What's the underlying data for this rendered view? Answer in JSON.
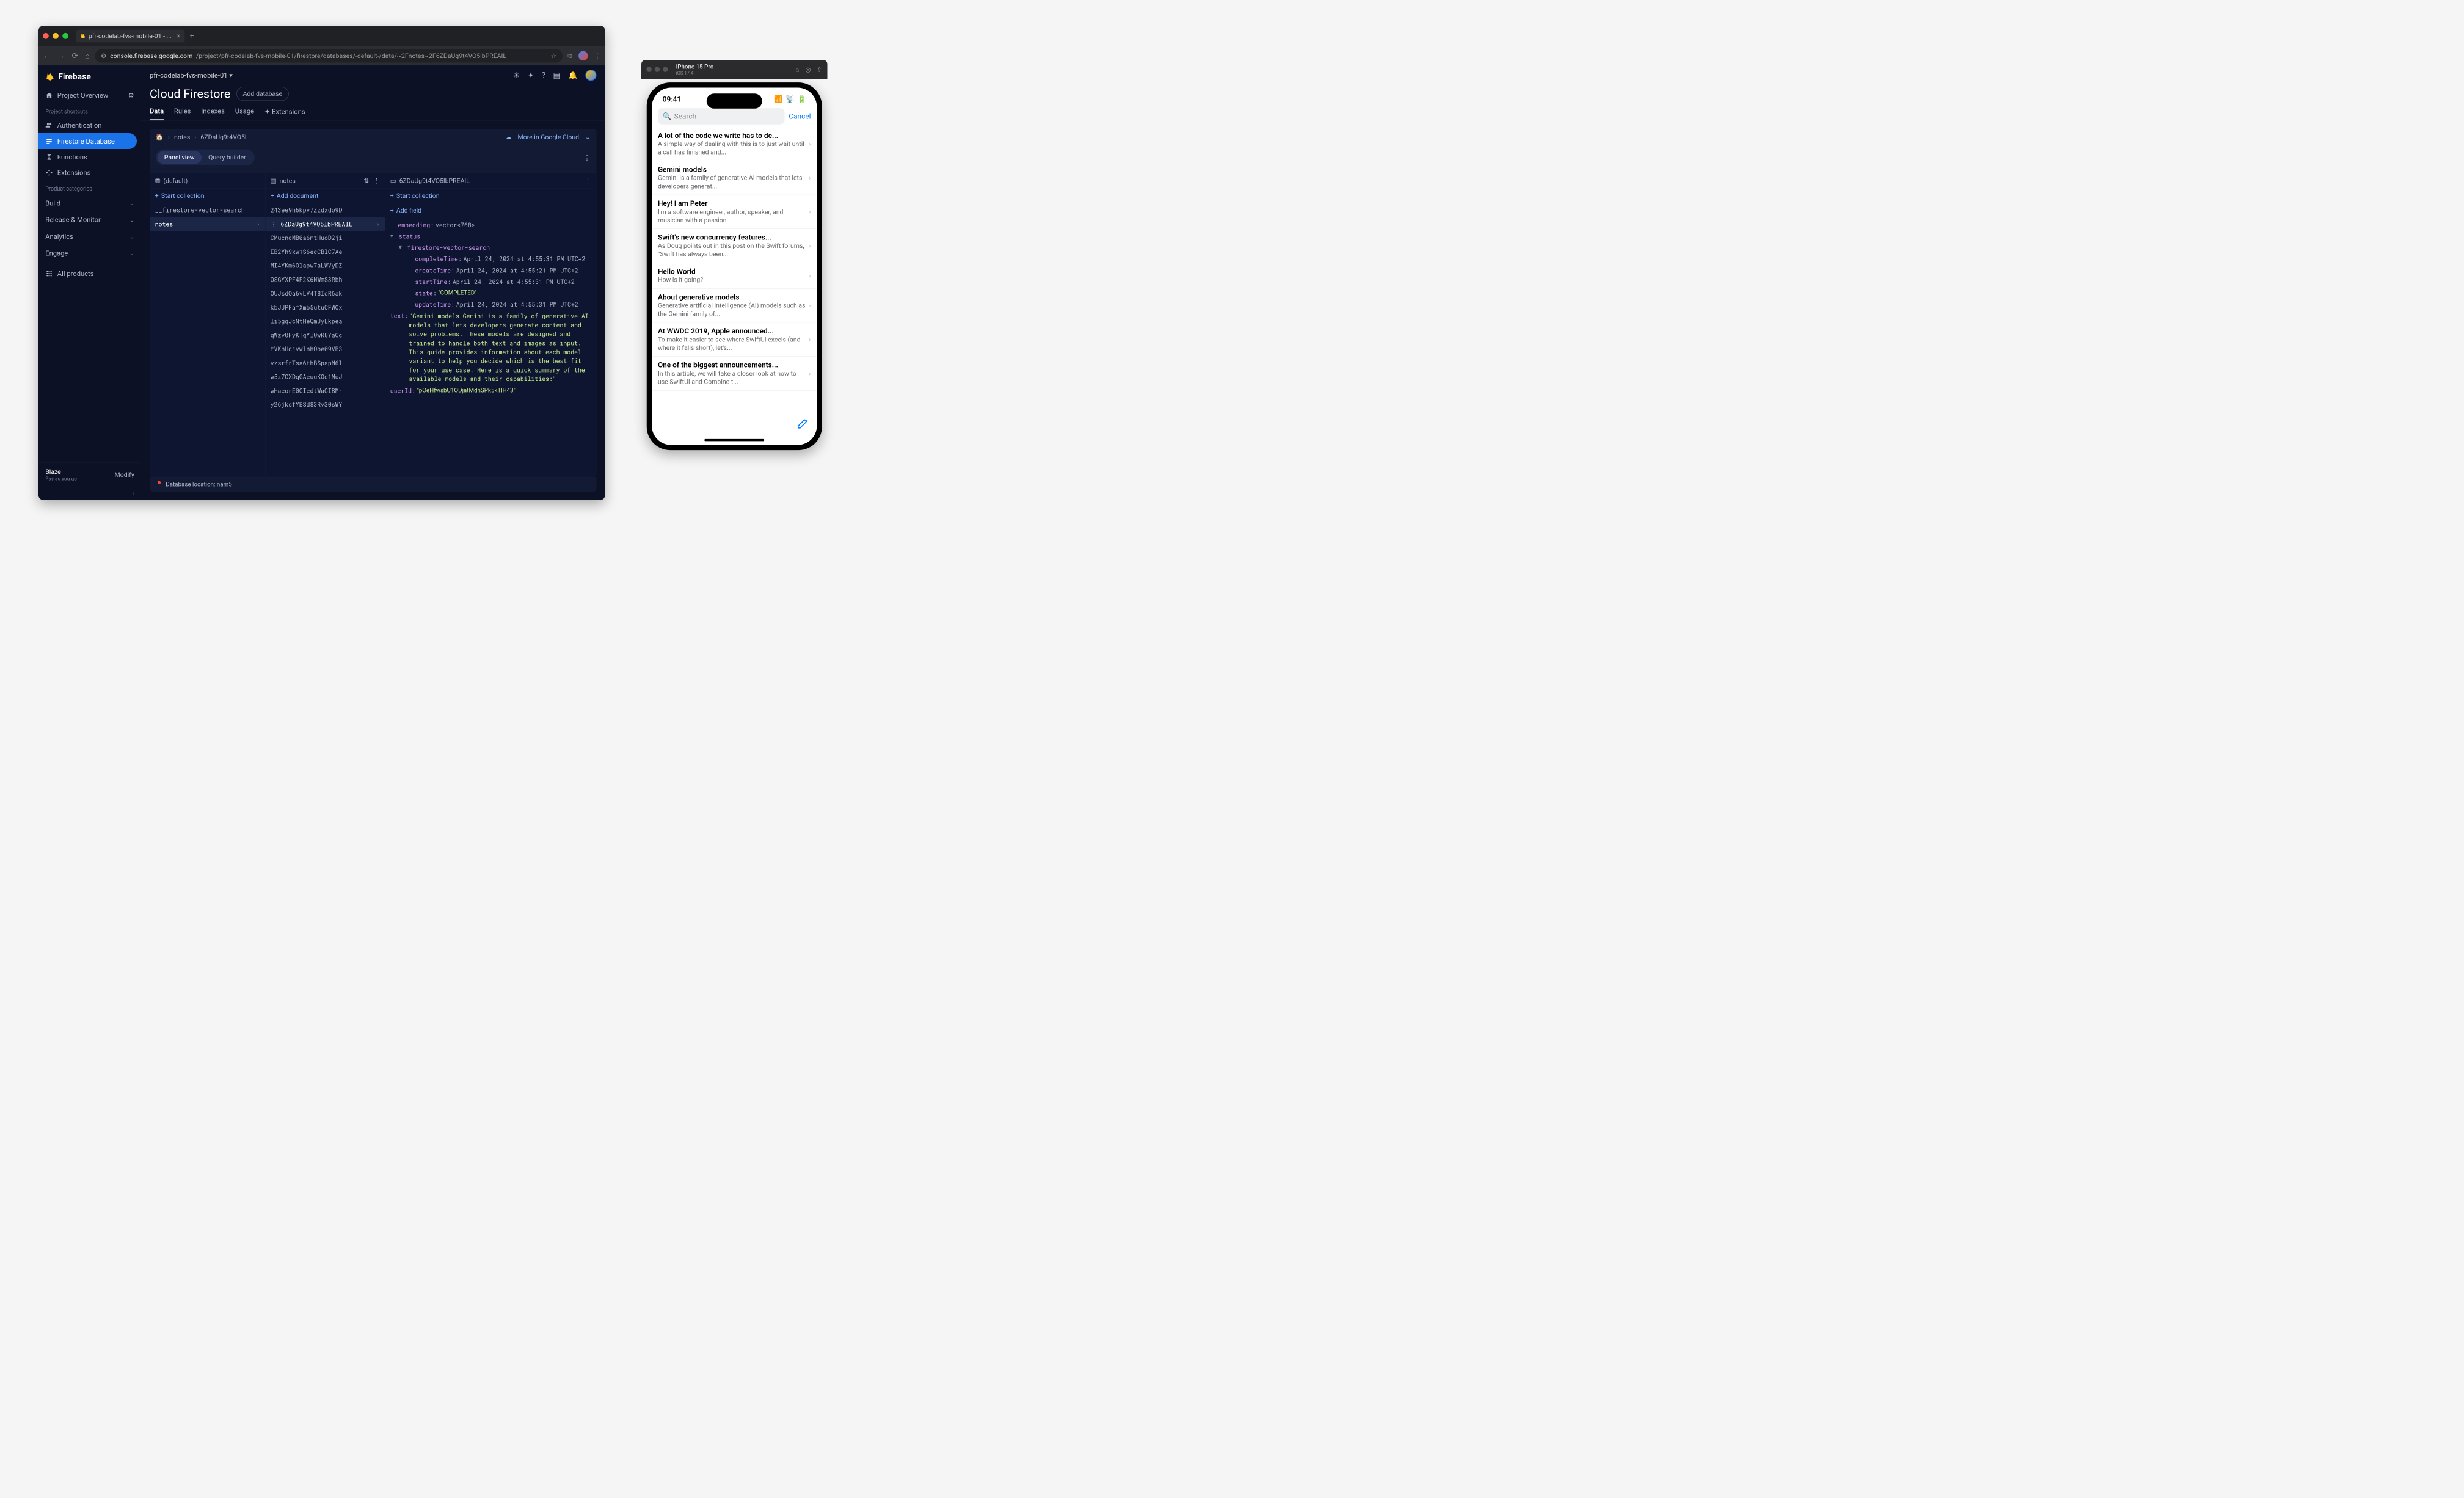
{
  "browser": {
    "tab_title": "pfr-codelab-fvs-mobile-01 - ...",
    "url_prefix": "console.firebase.google.com",
    "url_path": "/project/pfr-codelab-fvs-mobile-01/firestore/databases/-default-/data/~2Fnotes~2F6ZDaUg9t4VO5lbPREAIL"
  },
  "sidebar": {
    "brand": "Firebase",
    "overview": "Project Overview",
    "shortcuts_header": "Project shortcuts",
    "shortcuts": [
      "Authentication",
      "Firestore Database",
      "Functions",
      "Extensions"
    ],
    "categories_header": "Product categories",
    "categories": [
      "Build",
      "Release & Monitor",
      "Analytics",
      "Engage"
    ],
    "all_products": "All products",
    "plan_label": "Blaze",
    "plan_sub": "Pay as you go",
    "modify": "Modify"
  },
  "header": {
    "project": "pfr-codelab-fvs-mobile-01",
    "title": "Cloud Firestore",
    "add_db": "Add database",
    "tabs": [
      "Data",
      "Rules",
      "Indexes",
      "Usage",
      "Extensions"
    ]
  },
  "data": {
    "breadcrumb": [
      "notes",
      "6ZDaUg9t4VO5l..."
    ],
    "more_cloud": "More in Google Cloud",
    "panel_view": "Panel view",
    "query_builder": "Query builder",
    "col1": {
      "head": "(default)",
      "action": "Start collection",
      "items": [
        "__firestore-vector-search",
        "notes"
      ]
    },
    "col2": {
      "head": "notes",
      "action": "Add document",
      "items": [
        "243ee9h6kpv7Zzdxdo9D",
        "6ZDaUg9t4VO5lbPREAIL",
        "CMucncMB0a6mtHuoD2ji",
        "EB2Yh9xw1S6ecCBlC7Ae",
        "MI4YKm6Olapw7aLWVyDZ",
        "OSGYXPF4F2K6NWmS3Rbh",
        "OUJsdQa6vLV4T8IqR6ak",
        "kbJJPFafXmb5utuCFWOx",
        "li5gqJcNtHeQmJyLkpea",
        "qWzv0FyKTqYl0wR8YaCc",
        "tVKnHcjvwlnhOoe09VB3",
        "vzsrfrTsa6thBSpapN6l",
        "w5z7CXDqGAeuuKOe1MuJ",
        "wHaeorE0CIedtWaCIBMr",
        "y26jksfYBSd83Rv30sWY"
      ]
    },
    "col3": {
      "head": "6ZDaUg9t4VO5lbPREAIL",
      "start_collection": "Start collection",
      "add_field": "Add field",
      "fields": {
        "embedding": "vector<768>",
        "status_label": "status",
        "vector_search_label": "firestore-vector-search",
        "completeTime": "April 24, 2024 at 4:55:31 PM UTC+2",
        "createTime": "April 24, 2024 at 4:55:21 PM UTC+2",
        "startTime": "April 24, 2024 at 4:55:31 PM UTC+2",
        "state": "\"COMPLETED\"",
        "updateTime": "April 24, 2024 at 4:55:31 PM UTC+2",
        "text": "\"Gemini models Gemini is a family of generative AI models that lets developers generate content and solve problems. These models are designed and trained to handle both text and images as input. This guide provides information about each model variant to help you decide which is the best fit for your use case. Here is a quick summary of the available models and their capabilities:\"",
        "userId": "\"pOeHfwsbU1ODjatMdhSPk5kTlH43\""
      }
    },
    "footer": "Database location: nam5"
  },
  "simulator": {
    "device": "iPhone 15 Pro",
    "os": "iOS 17.4",
    "time": "09:41",
    "search_placeholder": "Search",
    "cancel": "Cancel",
    "notes": [
      {
        "title": "A lot of the code we write has to de...",
        "sub": "A simple way of dealing with this is to just wait until a call has finished and..."
      },
      {
        "title": "Gemini models",
        "sub": "Gemini is a family of generative AI models that lets developers generat..."
      },
      {
        "title": "Hey! I am Peter",
        "sub": "I'm a software engineer, author, speaker, and musician with a passion..."
      },
      {
        "title": "Swift's new concurrency features...",
        "sub": "As Doug points out in this post on the Swift forums, \"Swift has always been..."
      },
      {
        "title": "Hello World",
        "sub": "How is it going?"
      },
      {
        "title": "About generative models",
        "sub": "Generative artificial intelligence (AI) models such as the Gemini family of..."
      },
      {
        "title": "At WWDC 2019, Apple announced...",
        "sub": "To make it easier to see where SwiftUI excels (and where it falls short), let's..."
      },
      {
        "title": "One of the biggest announcements...",
        "sub": "In this article, we will take a closer look at how to use SwiftUI and Combine t..."
      }
    ]
  }
}
